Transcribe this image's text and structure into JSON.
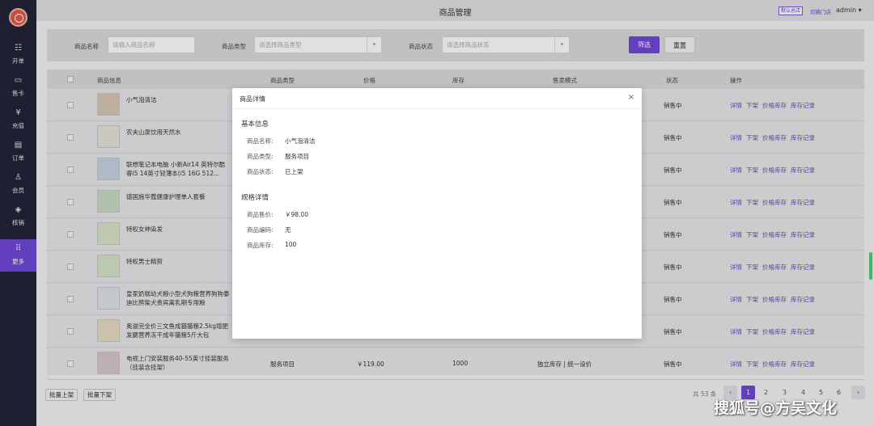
{
  "sidebar": {
    "items": [
      {
        "label": "开单",
        "icon": "cart-icon",
        "glyph": "☷"
      },
      {
        "label": "售卡",
        "icon": "card-icon",
        "glyph": "▭"
      },
      {
        "label": "充值",
        "icon": "yen-icon",
        "glyph": "¥"
      },
      {
        "label": "订单",
        "icon": "document-icon",
        "glyph": "▤"
      },
      {
        "label": "会员",
        "icon": "user-icon",
        "glyph": "♙"
      },
      {
        "label": "核销",
        "icon": "verify-icon",
        "glyph": "◈"
      },
      {
        "label": "更多",
        "icon": "grid-icon",
        "glyph": "⠿"
      }
    ]
  },
  "header": {
    "title": "商品管理",
    "default_store": "默认总店",
    "switch_store": "切换门店",
    "user": "admin",
    "user_caret": "▾"
  },
  "filter": {
    "name_label": "商品名称",
    "name_placeholder": "请输入商品名称",
    "type_label": "商品类型",
    "type_placeholder": "请选择商品类型",
    "status_label": "商品状态",
    "status_placeholder": "请选择商品状态",
    "caret": "▾",
    "filter_button": "筛选",
    "reset_button": "重置"
  },
  "table": {
    "headers": {
      "info": "商品信息",
      "type": "商品类型",
      "price": "价格",
      "stock": "库存",
      "mode": "售卖模式",
      "status": "状态",
      "ops": "操作"
    },
    "ops": [
      "详情",
      "下架",
      "价格库存",
      "库存记录"
    ],
    "rows": [
      {
        "name": "小气泡清洁",
        "type": "",
        "price": "",
        "stock": "",
        "mode": "",
        "status": "销售中"
      },
      {
        "name": "农夫山泉饮用天然水",
        "type": "",
        "price": "",
        "stock": "",
        "mode": "",
        "status": "销售中"
      },
      {
        "name": "联想笔记本电脑 小新Air14 英特尔酷睿i5 14英寸轻薄本(i5 16G 512...",
        "type": "",
        "price": "",
        "stock": "",
        "mode": "",
        "status": "销售中"
      },
      {
        "name": "德国施华蔻健康护理单人套餐",
        "type": "",
        "price": "",
        "stock": "",
        "mode": "",
        "status": "销售中"
      },
      {
        "name": "特权女神染发",
        "type": "",
        "price": "",
        "stock": "",
        "mode": "",
        "status": "销售中"
      },
      {
        "name": "特权男士精剪",
        "type": "",
        "price": "",
        "stock": "",
        "mode": "",
        "status": "销售中"
      },
      {
        "name": "皇家奶糕幼犬粮小型犬狗粮营养狗狗泰迪比熊柴犬贵宾离乳期专用粮",
        "type": "",
        "price": "",
        "stock": "",
        "mode": "",
        "status": "销售中"
      },
      {
        "name": "奥滋完全价三文鱼成猫猫粮2.5kg增肥发腮营养冻干成年猫粮5斤大包",
        "type": "",
        "price": "",
        "stock": "",
        "mode": "",
        "status": "销售中"
      },
      {
        "name": "电视上门安装服务40-55英寸挂装服务（挂装含挂架）",
        "type": "服务项目",
        "price": "￥119.00",
        "stock": "1000",
        "mode": "独立库存 | 统一设价",
        "status": "销售中"
      }
    ]
  },
  "bottom": {
    "batch_on": "批量上架",
    "batch_off": "批量下架",
    "total": "共 53 条",
    "prev": "‹",
    "next": "›",
    "pages": [
      "1",
      "2",
      "3",
      "4",
      "5",
      "6"
    ],
    "current_page": "1"
  },
  "modal": {
    "title": "商品详情",
    "close": "×",
    "basic_title": "基本信息",
    "basic": [
      {
        "label": "商品名称:",
        "value": "小气泡清洁"
      },
      {
        "label": "商品类型:",
        "value": "服务项目"
      },
      {
        "label": "商品状态:",
        "value": "已上架"
      }
    ],
    "spec_title": "规格详情",
    "spec": [
      {
        "label": "商品售价:",
        "value": "￥98.00"
      },
      {
        "label": "商品编码:",
        "value": "无"
      },
      {
        "label": "商品库存:",
        "value": "100"
      }
    ]
  },
  "watermark": "搜狐号@方吴文化"
}
